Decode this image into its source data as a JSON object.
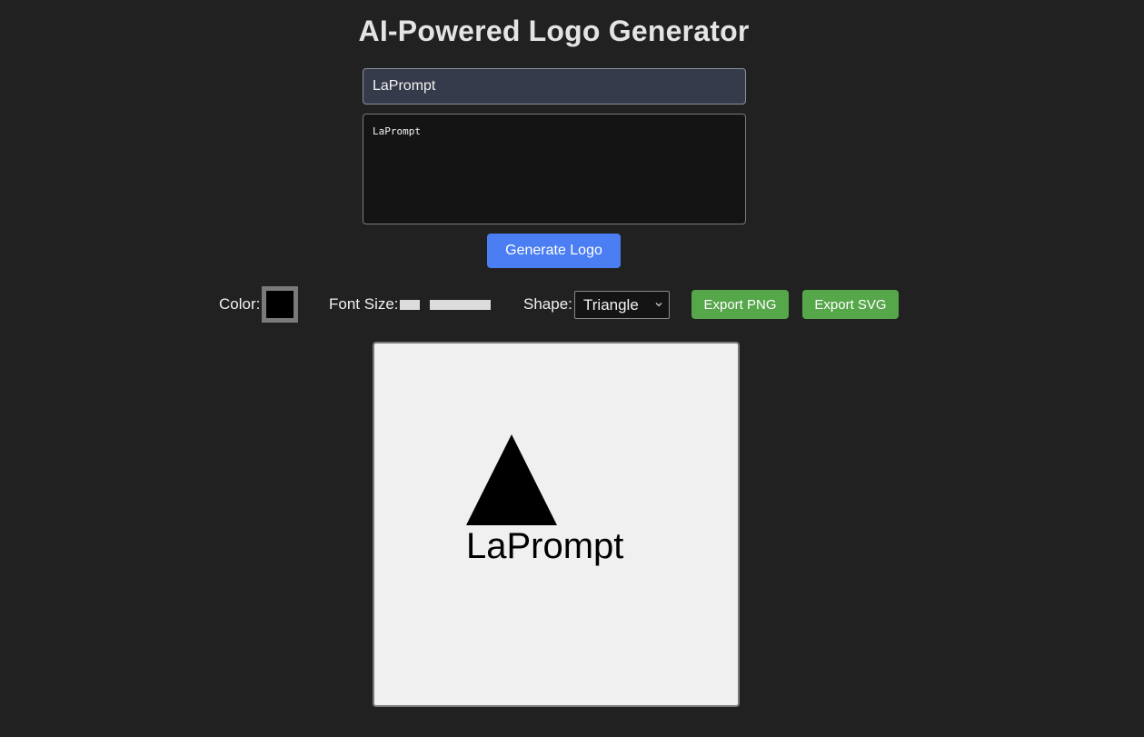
{
  "header": {
    "title": "AI-Powered Logo Generator"
  },
  "form": {
    "name_value": "LaPrompt",
    "prompt_value": "LaPrompt",
    "generate_label": "Generate Logo"
  },
  "controls": {
    "color_label": "Color:",
    "color_value": "#000000",
    "font_size_label": "Font Size:",
    "shape_label": "Shape:",
    "shape_value": "Triangle",
    "export_png_label": "Export PNG",
    "export_svg_label": "Export SVG"
  },
  "preview": {
    "logo_text": "LaPrompt",
    "shape": "triangle",
    "fill_color": "#000000",
    "background": "#f0f0f0"
  },
  "colors": {
    "page_bg": "#212121",
    "accent_blue": "#4a7ef2",
    "export_green": "#56a74a"
  }
}
